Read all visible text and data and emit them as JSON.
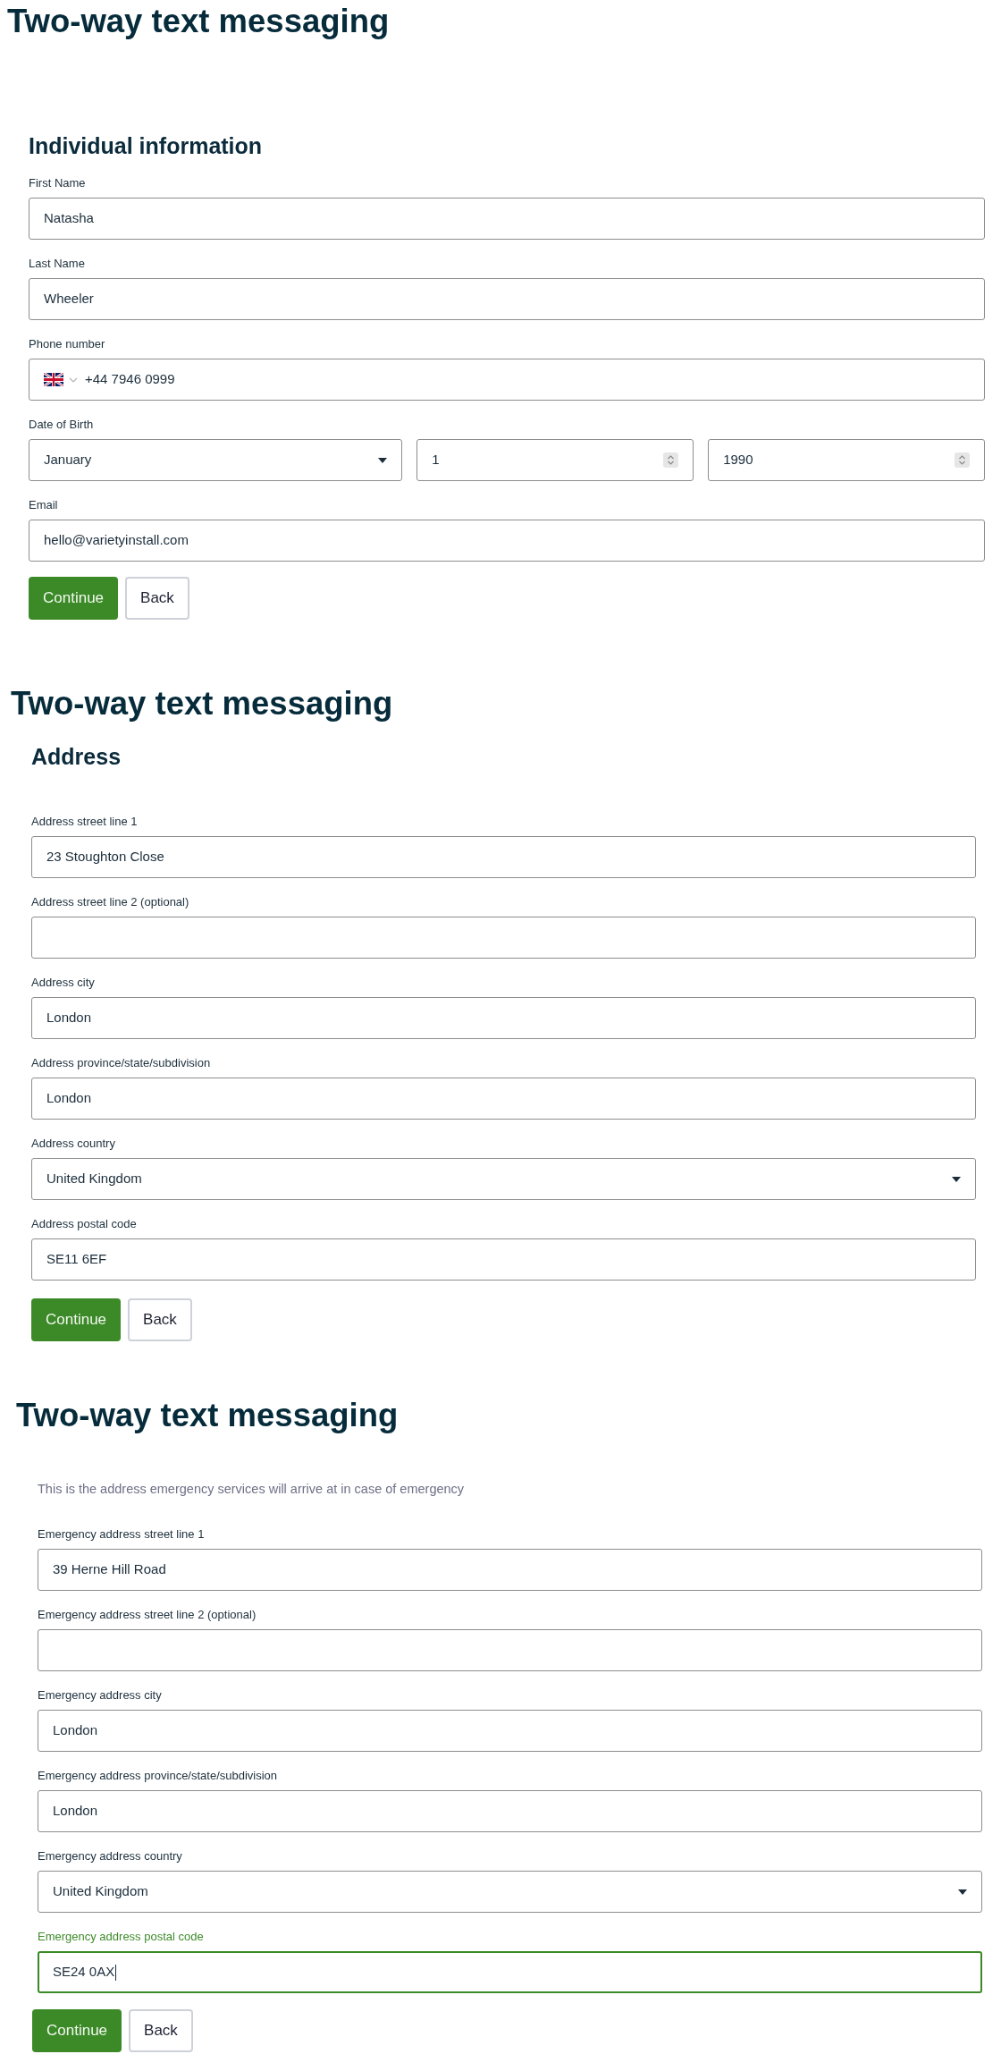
{
  "sections": [
    {
      "title": "Two-way text messaging",
      "heading": "Individual information",
      "fields": [
        {
          "kind": "text",
          "label": "First Name",
          "value": "Natasha",
          "focused": false
        },
        {
          "kind": "text",
          "label": "Last Name",
          "value": "Wheeler",
          "focused": false
        },
        {
          "kind": "phone",
          "label": "Phone number",
          "value": "+44 7946 0999",
          "focused": false
        },
        {
          "kind": "date",
          "label": "Date of Birth",
          "focused": false,
          "parts": [
            {
              "kind": "select",
              "value": "January"
            },
            {
              "kind": "number",
              "value": "1"
            },
            {
              "kind": "number",
              "value": "1990"
            }
          ]
        },
        {
          "kind": "text",
          "label": "Email",
          "value": "hello@varietyinstall.com",
          "focused": false
        }
      ],
      "buttons": [
        {
          "kind": "continue",
          "label": "Continue"
        },
        {
          "kind": "back",
          "label": "Back"
        }
      ]
    },
    {
      "title": "Two-way text messaging",
      "heading": "Address",
      "fields": [
        {
          "kind": "text",
          "label": "Address street line 1",
          "value": "23 Stoughton Close",
          "focused": false
        },
        {
          "kind": "text",
          "label": "Address street line 2 (optional)",
          "focused": false
        },
        {
          "kind": "text",
          "label": "Address city",
          "value": "London",
          "focused": false
        },
        {
          "kind": "text",
          "label": "Address province/state/subdivision",
          "value": "London",
          "focused": false
        },
        {
          "kind": "select",
          "label": "Address country",
          "value": "United Kingdom",
          "focused": false
        },
        {
          "kind": "text",
          "label": "Address postal code",
          "value": "SE11 6EF",
          "focused": false
        }
      ],
      "buttons": [
        {
          "kind": "continue",
          "label": "Continue"
        },
        {
          "kind": "back",
          "label": "Back"
        }
      ]
    },
    {
      "title": "Two-way text messaging",
      "description": "This is the address emergency services will arrive at in case of emergency",
      "fields": [
        {
          "kind": "text",
          "label": "Emergency address street line 1",
          "value": "39 Herne Hill Road",
          "focused": false
        },
        {
          "kind": "text",
          "label": "Emergency address street line 2 (optional)",
          "focused": false
        },
        {
          "kind": "text",
          "label": "Emergency address city",
          "value": "London",
          "focused": false
        },
        {
          "kind": "text",
          "label": "Emergency address province/state/subdivision",
          "value": "London",
          "focused": false
        },
        {
          "kind": "select",
          "label": "Emergency address country",
          "value": "United Kingdom",
          "focused": false
        },
        {
          "kind": "text",
          "label": "Emergency address postal code",
          "value": "SE24 0AX",
          "focused": true
        }
      ],
      "buttons": [
        {
          "kind": "continue",
          "label": "Continue"
        },
        {
          "kind": "back",
          "label": "Back"
        }
      ]
    }
  ]
}
